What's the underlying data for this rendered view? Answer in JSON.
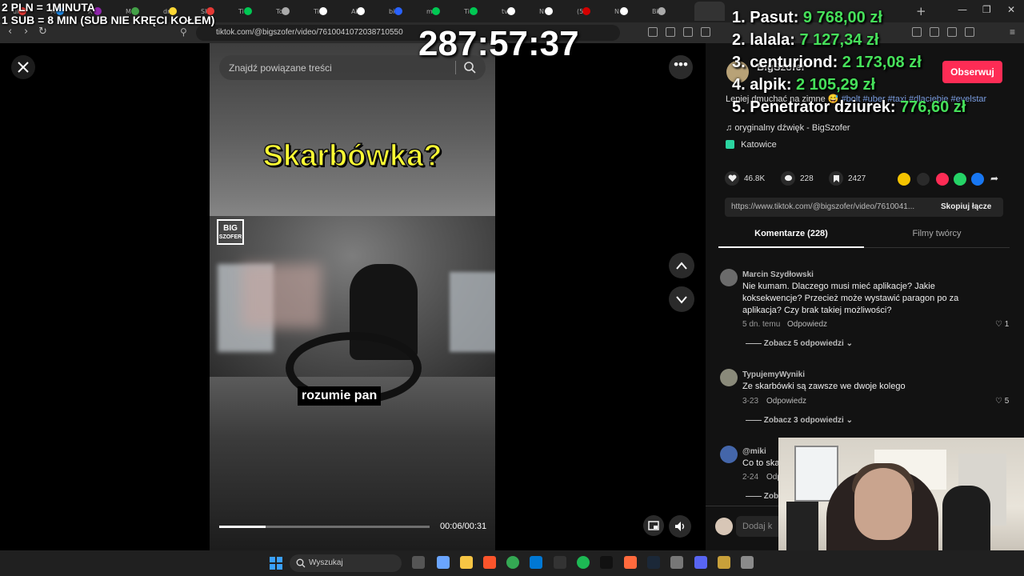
{
  "browser": {
    "url": "tiktok.com/@bigszofer/video/7610041072038710550",
    "tab_texts": [
      "ul",
      "M",
      "X",
      "M",
      "dr",
      "SI",
      "Ti",
      "Tc",
      "Ti",
      "Ai",
      "bi",
      "m",
      "Ti",
      "tv",
      "N",
      "(5",
      "N",
      "Bi"
    ],
    "active_tab_label": "Bi",
    "new_tab": "+",
    "window_controls": {
      "minimize": "—",
      "maximize": "❐",
      "close": "✕"
    },
    "nav": {
      "back": "‹",
      "forward": "›",
      "reload": "↻"
    }
  },
  "overlay": {
    "line1": "2 PLN = 1MINUTA",
    "line2": "1 SUB = 8 MIN (SUB NIE KRĘCI KOŁEM)",
    "timer": "287:57:37"
  },
  "leaderboard": [
    {
      "rank": "1.",
      "name": "Pasut:",
      "amount": "9 768,00 zł"
    },
    {
      "rank": "2.",
      "name": "lalala:",
      "amount": "7 127,34 zł"
    },
    {
      "rank": "3.",
      "name": "centuriond:",
      "amount": "2 173,08 zł"
    },
    {
      "rank": "4.",
      "name": "alpik:",
      "amount": "2 105,29 zł"
    },
    {
      "rank": "5.",
      "name": "Penetrator dziurek:",
      "amount": "776,60 zł"
    }
  ],
  "video": {
    "search_placeholder": "Znajdź powiązane treści",
    "headline": "Skarbówka?",
    "logo_line1": "BIG",
    "logo_line2": "SZOFER",
    "subtitle": "rozumie pan",
    "time": "00:06/00:31",
    "progress": 0.22
  },
  "post": {
    "author": "BigSzofer",
    "follow_label": "Obserwuj",
    "description": "Lepiej dmuchać na zimne 😅",
    "hashtags": "#bolt #uber #taxi #dlaciebie #evelstar",
    "sound": "oryginalny dźwięk - BigSzofer",
    "location": "Katowice",
    "likes": "46.8K",
    "comments_count": "228",
    "saves": "2427",
    "link": "https://www.tiktok.com/@bigszofer/video/7610041...",
    "copy_label": "Skopiuj łącze",
    "tab_comments": "Komentarze (228)",
    "tab_creator": "Filmy twórcy"
  },
  "comments": [
    {
      "user": "Marcin Szydłowski",
      "text": "Nie kumam. Dlaczego musi mieć aplikacje? Jakie koksekwencje? Przecież może wystawić paragon po za aplikacja? Czy brak takiej możliwości?",
      "date": "5 dn. temu",
      "reply": "Odpowiedz",
      "likes": "1",
      "more": "Zobacz 5 odpowiedzi"
    },
    {
      "user": "TypujemyWyniki",
      "text": "Ze skarbówki są zawsze we dwoje kolego",
      "date": "3-23",
      "reply": "Odpowiedz",
      "likes": "5",
      "more": "Zobacz 3 odpowiedzi"
    },
    {
      "user": "@miki",
      "text": "Co to ska",
      "date": "2-24",
      "reply": "Odp",
      "likes": "",
      "more": "Zob"
    }
  ],
  "add_comment_placeholder": "Dodaj k",
  "taskbar": {
    "search_label": "Wyszukaj"
  },
  "colors": {
    "accent": "#fe2c55",
    "leaderboard_amount": "#46e05a",
    "headline": "#ffff33"
  }
}
